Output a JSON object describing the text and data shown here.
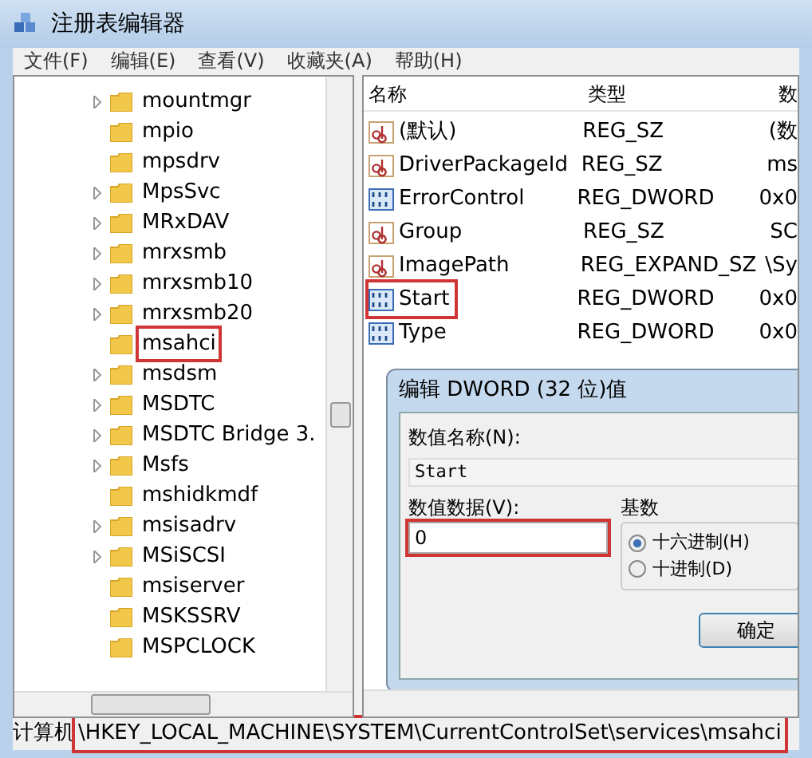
{
  "window": {
    "title": "注册表编辑器"
  },
  "menu": [
    "文件(F)",
    "编辑(E)",
    "查看(V)",
    "收藏夹(A)",
    "帮助(H)"
  ],
  "tree": [
    {
      "label": "mountmgr",
      "has_children": true,
      "highlighted": false
    },
    {
      "label": "mpio",
      "has_children": false,
      "highlighted": false
    },
    {
      "label": "mpsdrv",
      "has_children": false,
      "highlighted": false
    },
    {
      "label": "MpsSvc",
      "has_children": true,
      "highlighted": false
    },
    {
      "label": "MRxDAV",
      "has_children": true,
      "highlighted": false
    },
    {
      "label": "mrxsmb",
      "has_children": true,
      "highlighted": false
    },
    {
      "label": "mrxsmb10",
      "has_children": true,
      "highlighted": false
    },
    {
      "label": "mrxsmb20",
      "has_children": true,
      "highlighted": false
    },
    {
      "label": "msahci",
      "has_children": false,
      "highlighted": true
    },
    {
      "label": "msdsm",
      "has_children": true,
      "highlighted": false
    },
    {
      "label": "MSDTC",
      "has_children": true,
      "highlighted": false
    },
    {
      "label": "MSDTC Bridge 3.",
      "has_children": true,
      "highlighted": false
    },
    {
      "label": "Msfs",
      "has_children": true,
      "highlighted": false
    },
    {
      "label": "mshidkmdf",
      "has_children": false,
      "highlighted": false
    },
    {
      "label": "msisadrv",
      "has_children": true,
      "highlighted": false
    },
    {
      "label": "MSiSCSI",
      "has_children": true,
      "highlighted": false
    },
    {
      "label": "msiserver",
      "has_children": false,
      "highlighted": false
    },
    {
      "label": "MSKSSRV",
      "has_children": false,
      "highlighted": false
    },
    {
      "label": "MSPCLOCK",
      "has_children": false,
      "highlighted": false
    }
  ],
  "values": {
    "columns": [
      "名称",
      "类型",
      "数"
    ],
    "rows": [
      {
        "kind": "string",
        "name": "(默认)",
        "type": "REG_SZ",
        "data": "(数",
        "highlighted": false
      },
      {
        "kind": "string",
        "name": "DriverPackageId",
        "type": "REG_SZ",
        "data": "ms",
        "highlighted": false
      },
      {
        "kind": "binary",
        "name": "ErrorControl",
        "type": "REG_DWORD",
        "data": "0x0",
        "highlighted": false
      },
      {
        "kind": "string",
        "name": "Group",
        "type": "REG_SZ",
        "data": "SC",
        "highlighted": false
      },
      {
        "kind": "string",
        "name": "ImagePath",
        "type": "REG_EXPAND_SZ",
        "data": "\\Sy",
        "highlighted": false
      },
      {
        "kind": "binary",
        "name": "Start",
        "type": "REG_DWORD",
        "data": "0x0",
        "highlighted": true
      },
      {
        "kind": "binary",
        "name": "Type",
        "type": "REG_DWORD",
        "data": "0x0",
        "highlighted": false
      }
    ]
  },
  "dialog": {
    "title": "编辑 DWORD (32 位)值",
    "name_label": "数值名称(N):",
    "name_value": "Start",
    "data_label": "数值数据(V):",
    "data_value": "0",
    "data_highlighted": true,
    "base_label": "基数",
    "radios": [
      {
        "label": "十六进制(H)",
        "selected": true
      },
      {
        "label": "十进制(D)",
        "selected": false
      }
    ],
    "ok": "确定"
  },
  "status_bar": {
    "prefix": "计算机",
    "path": "\\HKEY_LOCAL_MACHINE\\SYSTEM\\CurrentControlSet\\services\\msahci",
    "highlighted": true
  }
}
